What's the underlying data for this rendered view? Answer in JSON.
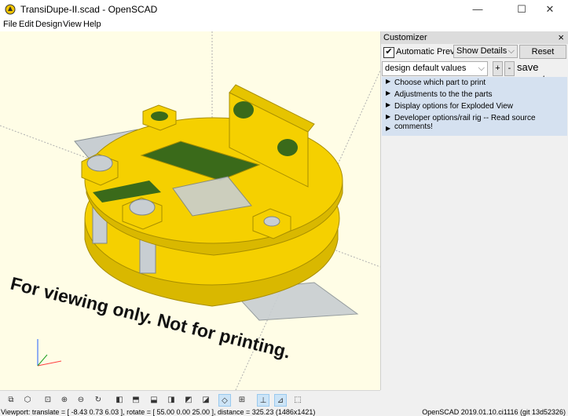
{
  "window": {
    "title": "TransiDupe-II.scad - OpenSCAD",
    "minimize": "—",
    "maximize": "☐",
    "close": "✕"
  },
  "menu": [
    "File",
    "Edit",
    "Design",
    "View",
    "Help"
  ],
  "viewport": {
    "overlay_text": "For viewing only.  Not for printing.",
    "colors": {
      "background": "#fffde6",
      "part": "#f5d000",
      "part_edge": "#c9a800",
      "ghost": "#b8c2c8"
    }
  },
  "customizer": {
    "title": "Customizer",
    "close_icon": "×",
    "auto_preview_checked": true,
    "auto_preview_label": "Automatic Preview",
    "details_value": "Show Details",
    "reset_label": "Reset",
    "preset_value": "design default values",
    "plus_label": "+",
    "minus_label": "-",
    "save_preset_label": "save preset",
    "groups": [
      "Choose which part to print",
      "Adjustments to the the parts",
      "Display options for Exploded View",
      "Developer options/rail rig -- Read source comments!",
      ""
    ]
  },
  "toolbar": {
    "icons": [
      "preview-icon",
      "render-icon",
      "view-all-icon",
      "zoom-in-icon",
      "zoom-out-icon",
      "reset-view-icon",
      "view-right-icon",
      "view-top-icon",
      "view-bottom-icon",
      "view-left-icon",
      "view-front-icon",
      "view-back-icon",
      "diagonal-view-icon",
      "center-view-icon",
      "perspective-icon",
      "orthogonal-icon",
      "show-axes-icon",
      "show-scale-icon",
      "show-edges-icon"
    ],
    "active": [
      "diagonal-view-icon",
      "show-axes-icon",
      "show-scale-icon"
    ]
  },
  "status": {
    "left": "Viewport: translate = [ -8.43 0.73 6.03 ], rotate = [ 55.00 0.00 25.00 ], distance = 325.23 (1486x1421)",
    "right": "OpenSCAD 2019.01.10.ci1116 (git 13d52326)"
  }
}
